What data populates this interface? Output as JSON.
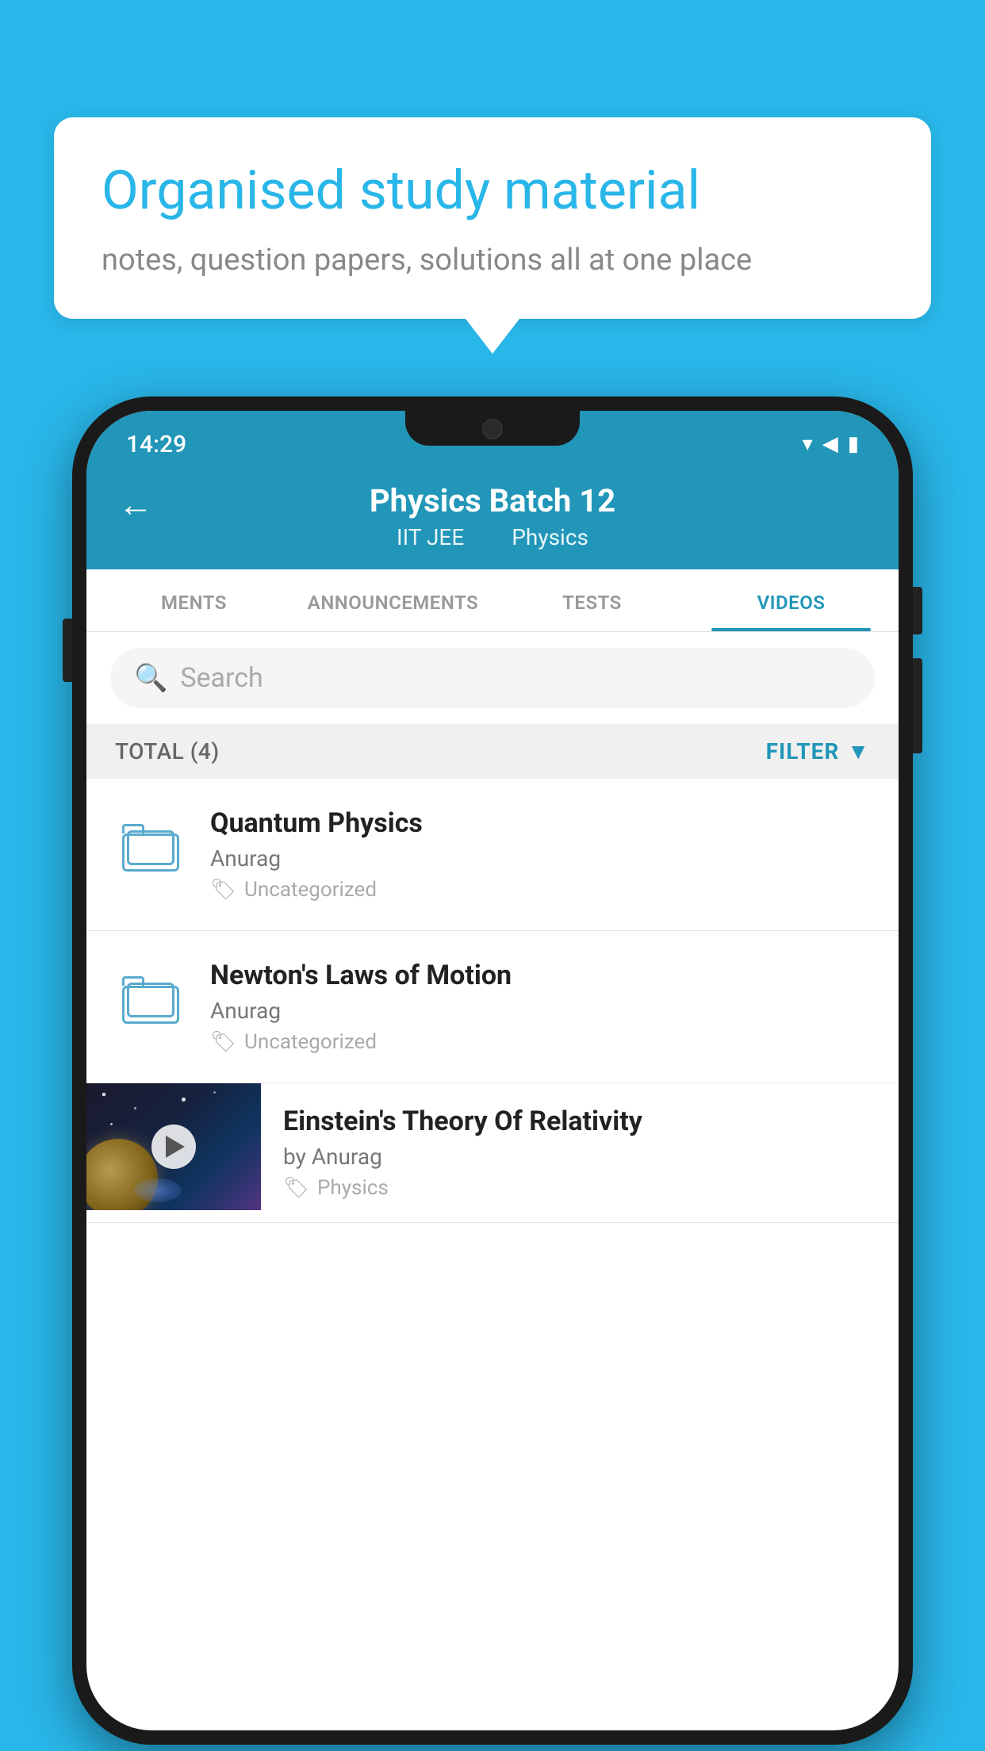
{
  "background_color": "#29b6e8",
  "speech_bubble": {
    "title": "Organised study material",
    "subtitle": "notes, question papers, solutions all at one place"
  },
  "status_bar": {
    "time": "14:29",
    "wifi": "▾",
    "signal": "▲",
    "battery": "▮"
  },
  "header": {
    "back_label": "←",
    "title": "Physics Batch 12",
    "tag1": "IIT JEE",
    "tag2": "Physics"
  },
  "tabs": [
    {
      "label": "MENTS",
      "active": false
    },
    {
      "label": "ANNOUNCEMENTS",
      "active": false
    },
    {
      "label": "TESTS",
      "active": false
    },
    {
      "label": "VIDEOS",
      "active": true
    }
  ],
  "search": {
    "placeholder": "Search"
  },
  "filter_bar": {
    "total_label": "TOTAL (4)",
    "filter_label": "FILTER"
  },
  "items": [
    {
      "id": 1,
      "title": "Quantum Physics",
      "author": "Anurag",
      "tag": "Uncategorized",
      "type": "folder"
    },
    {
      "id": 2,
      "title": "Newton's Laws of Motion",
      "author": "Anurag",
      "tag": "Uncategorized",
      "type": "folder"
    },
    {
      "id": 3,
      "title": "Einstein's Theory Of Relativity",
      "author": "by Anurag",
      "tag": "Physics",
      "type": "video"
    }
  ]
}
